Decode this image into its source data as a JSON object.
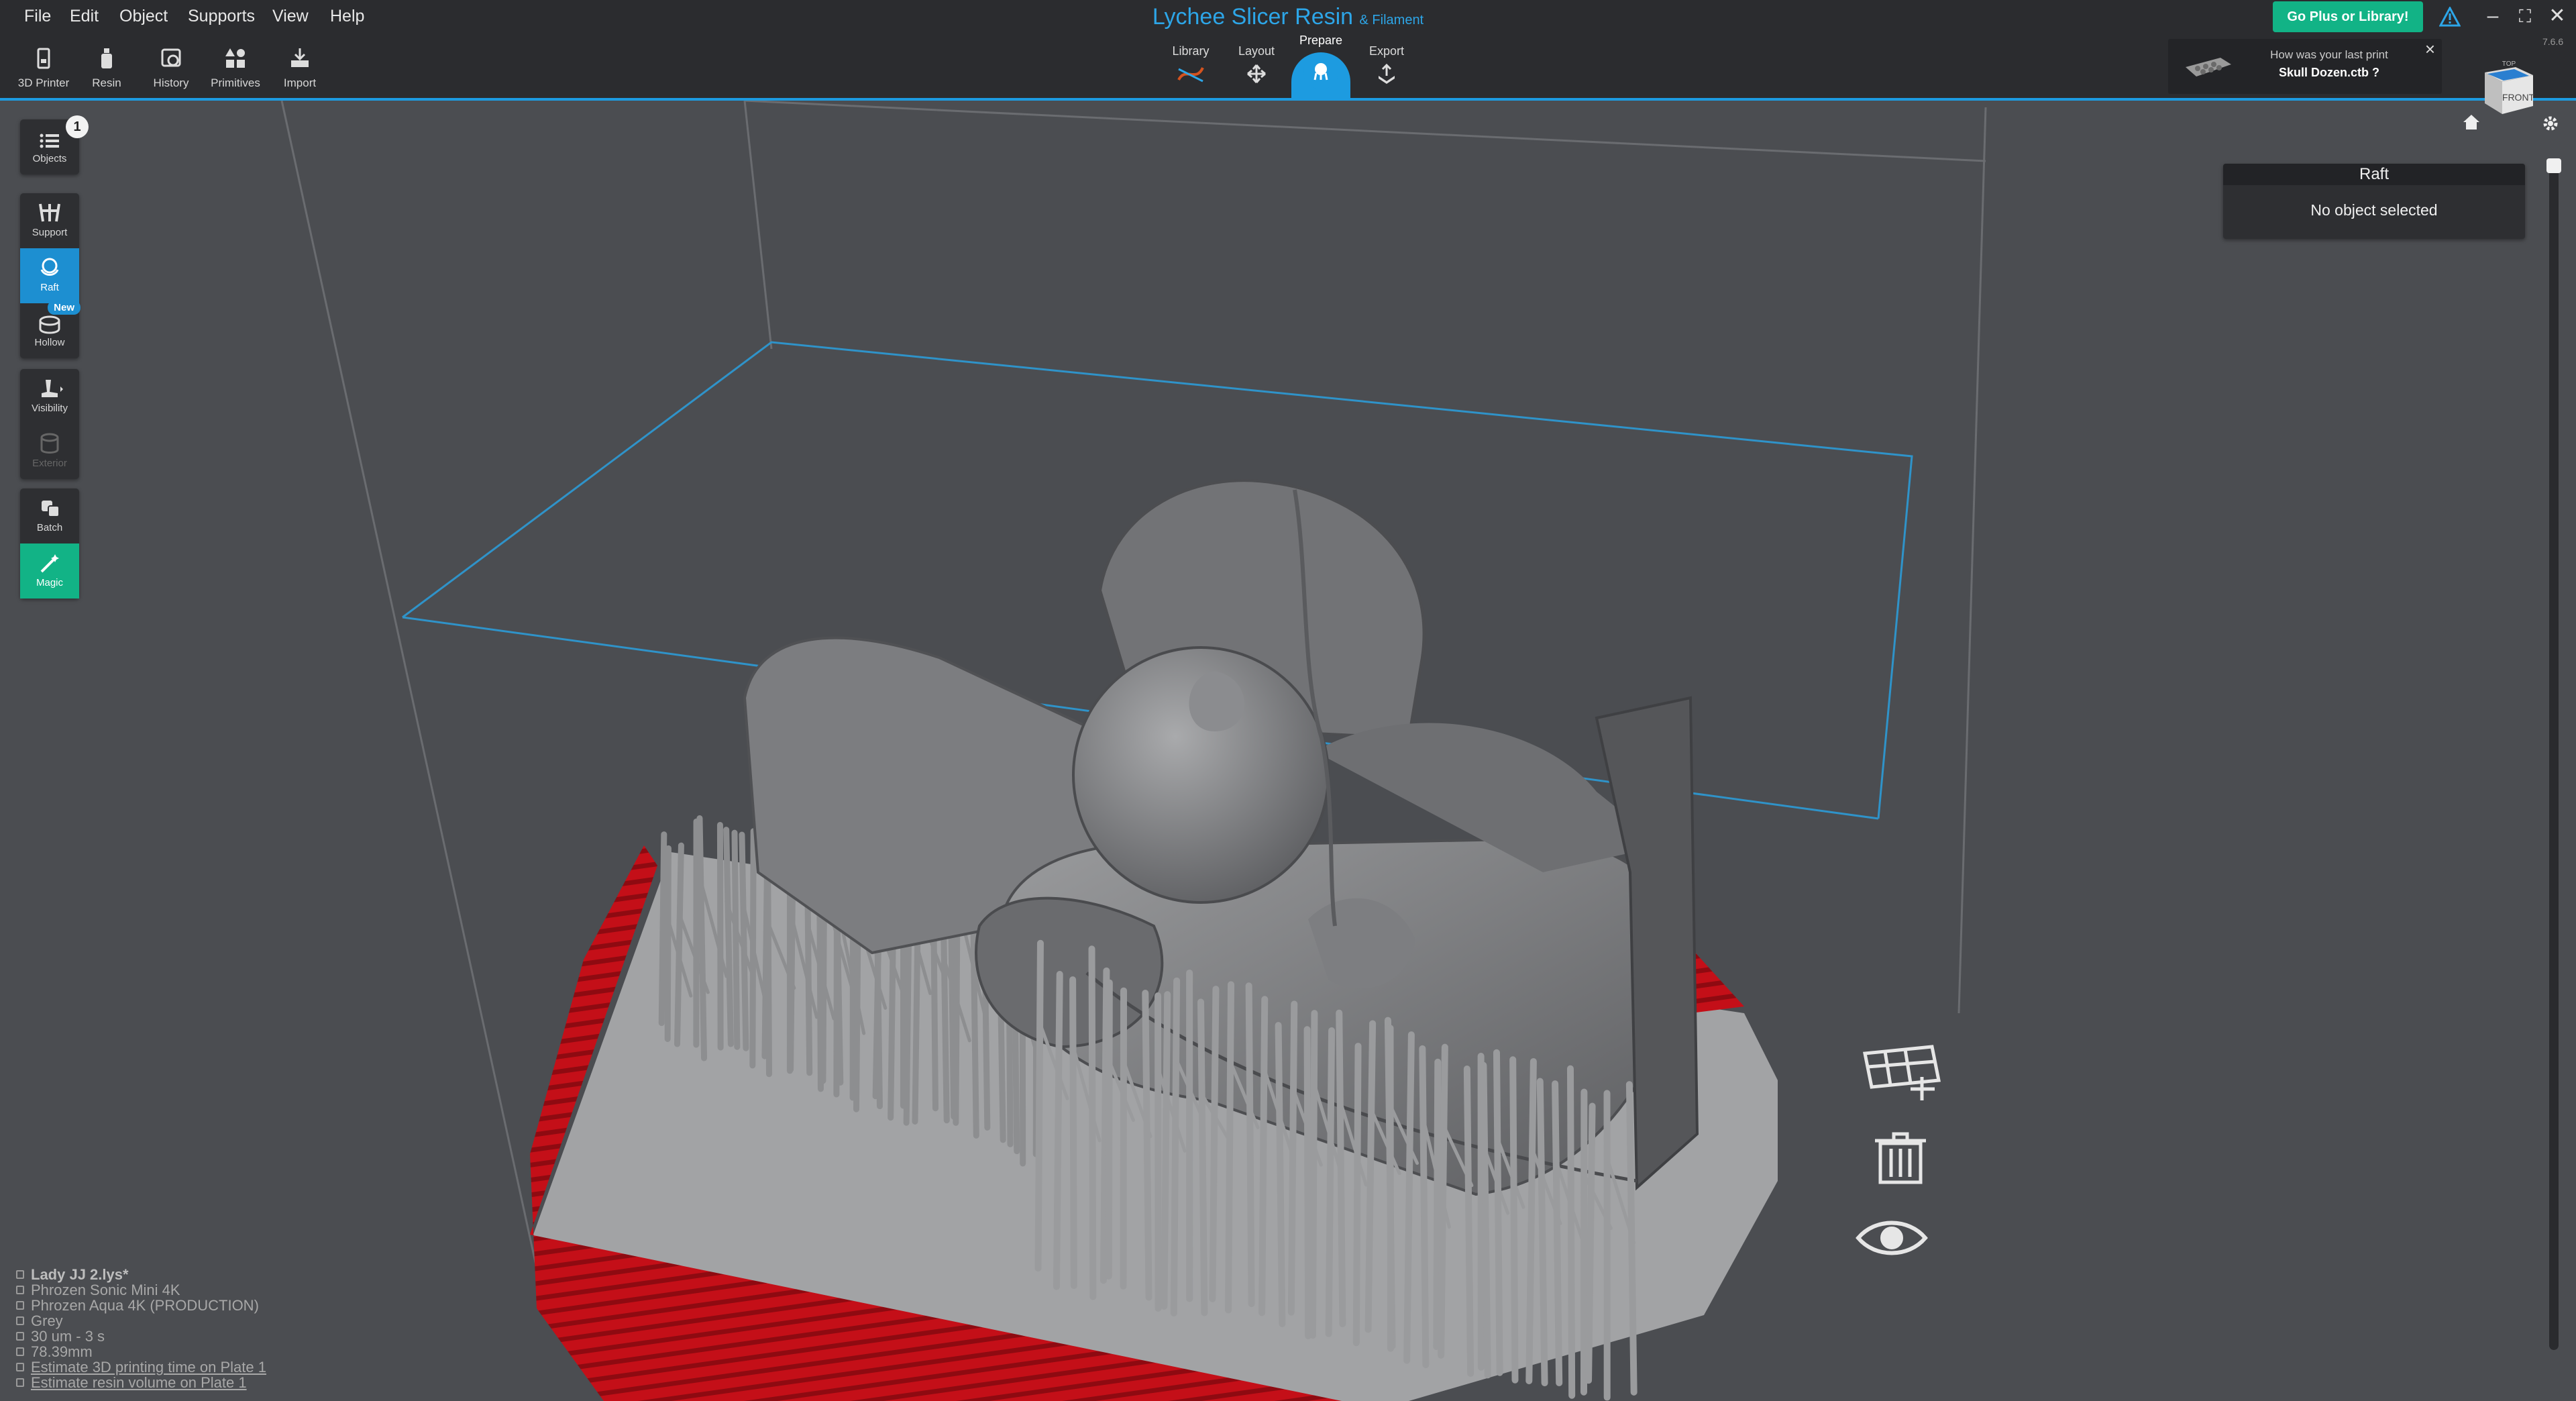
{
  "menu": [
    "File",
    "Edit",
    "Object",
    "Supports",
    "View",
    "Help"
  ],
  "toolbar": [
    {
      "label": "3D Printer",
      "icon": "printer-icon"
    },
    {
      "label": "Resin",
      "icon": "resin-bottle-icon"
    },
    {
      "label": "History",
      "icon": "history-icon"
    },
    {
      "label": "Primitives",
      "icon": "primitives-icon"
    },
    {
      "label": "Import",
      "icon": "import-icon"
    }
  ],
  "app": {
    "title": "Lychee Slicer Resin",
    "subtitle": "& Filament",
    "version": "7.6.6"
  },
  "stages": {
    "library": "Library",
    "layout": "Layout",
    "prepare": "Prepare",
    "export": "Export",
    "active": "Prepare"
  },
  "header_actions": {
    "go_plus": "Go Plus or Library!"
  },
  "notification": {
    "question": "How was your last print",
    "file": "Skull Dozen.ctb ?"
  },
  "viewcube": {
    "face": "FRONT",
    "top": "TOP"
  },
  "left_toolbar": {
    "objects": {
      "label": "Objects",
      "count": "1"
    },
    "support": "Support",
    "raft": "Raft",
    "hollow": "Hollow",
    "new_badge": "New",
    "visibility": "Visibility",
    "exterior": "Exterior",
    "batch": "Batch",
    "magic": "Magic"
  },
  "raft_panel": {
    "title": "Raft",
    "message": "No object selected"
  },
  "file_info": {
    "project": "Lady JJ 2.lys*",
    "printer": "Phrozen Sonic Mini 4K",
    "resin": "Phrozen Aqua 4K (PRODUCTION)",
    "color": "Grey",
    "layer": "30 um - 3 s",
    "height": "78.39mm",
    "estimate_time": "Estimate 3D printing time on Plate 1",
    "estimate_volume": "Estimate resin volume on Plate 1"
  },
  "colors": {
    "accent": "#1d9be0",
    "plus_button": "#12b386",
    "raft": "#c0121a",
    "model": "#8a8b8d",
    "background": "#4b4d51"
  }
}
